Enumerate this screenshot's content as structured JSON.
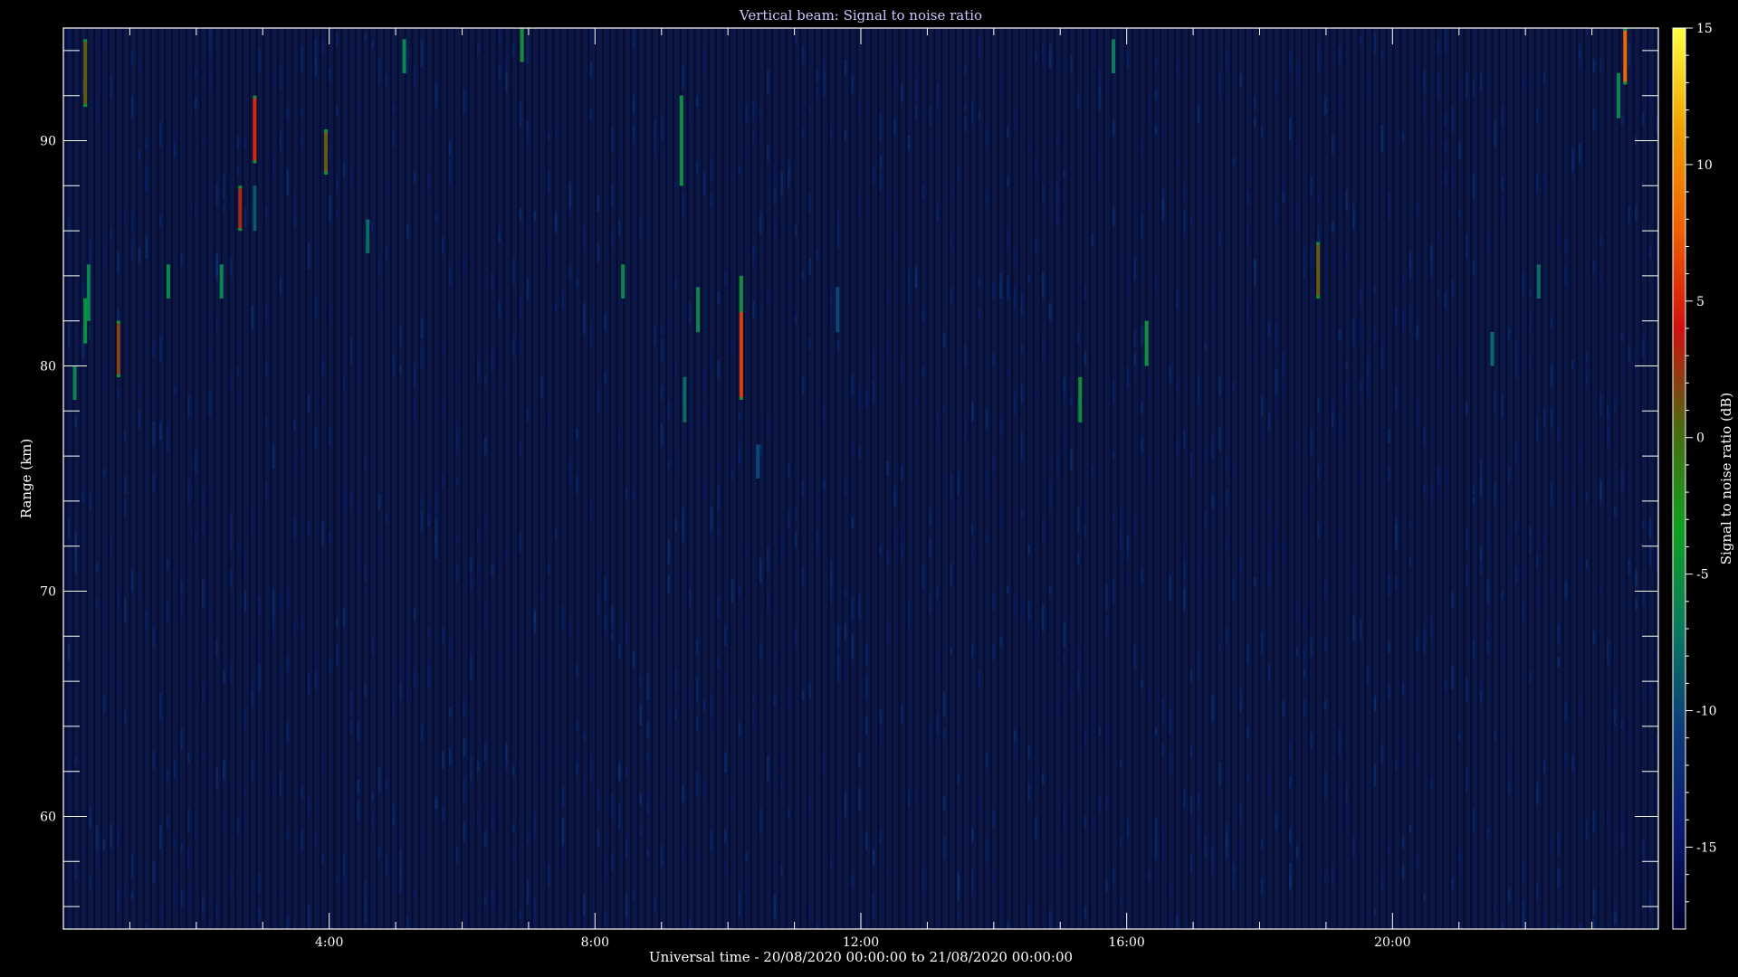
{
  "chart_data": {
    "type": "heatmap",
    "title": "Vertical beam: Signal to noise ratio",
    "xlabel": "Universal time - 20/08/2020 00:00:00 to 21/08/2020 00:00:00",
    "ylabel": "Range (km)",
    "x_unit": "hours UT",
    "xlim": [
      0,
      24
    ],
    "ylim": [
      55,
      95
    ],
    "x_ticks": [
      4,
      8,
      12,
      16,
      20
    ],
    "x_tick_labels": [
      "4:00",
      "8:00",
      "12:00",
      "16:00",
      "20:00"
    ],
    "y_ticks": [
      60,
      70,
      80,
      90
    ],
    "y_tick_labels": [
      "60",
      "70",
      "80",
      "90"
    ],
    "colorbar": {
      "label": "Signal to noise ratio (dB)",
      "range": [
        -18,
        15
      ],
      "ticks": [
        -15,
        -10,
        -5,
        0,
        5,
        10,
        15
      ],
      "tick_labels": [
        "-15",
        "-10",
        "-5",
        "0",
        "5",
        "10",
        "15"
      ],
      "colors": [
        "#000030",
        "#0a1a6e",
        "#0c3a7a",
        "#0a7a60",
        "#10a020",
        "#4a6a10",
        "#d01010",
        "#f06000",
        "#f0a000",
        "#ffff40"
      ]
    },
    "background_snr_db": -16,
    "features": [
      {
        "t": 0.17,
        "r0": 78.5,
        "r1": 80.0,
        "snr": -6
      },
      {
        "t": 0.33,
        "r0": 91.5,
        "r1": 94.5,
        "snr": 1
      },
      {
        "t": 0.33,
        "r0": 81.0,
        "r1": 83.0,
        "snr": -5
      },
      {
        "t": 0.38,
        "r0": 82.0,
        "r1": 84.5,
        "snr": -6
      },
      {
        "t": 0.83,
        "r0": 79.5,
        "r1": 82.0,
        "snr": 2
      },
      {
        "t": 1.58,
        "r0": 83.0,
        "r1": 84.5,
        "snr": -6
      },
      {
        "t": 2.38,
        "r0": 83.0,
        "r1": 84.5,
        "snr": -6
      },
      {
        "t": 2.66,
        "r0": 86.0,
        "r1": 88.0,
        "snr": 3
      },
      {
        "t": 2.88,
        "r0": 89.0,
        "r1": 92.0,
        "snr": 5
      },
      {
        "t": 2.88,
        "r0": 86.0,
        "r1": 88.0,
        "snr": -9
      },
      {
        "t": 3.95,
        "r0": 88.5,
        "r1": 90.5,
        "snr": 1
      },
      {
        "t": 4.58,
        "r0": 85.0,
        "r1": 86.5,
        "snr": -8
      },
      {
        "t": 5.13,
        "r0": 93.0,
        "r1": 94.5,
        "snr": -6
      },
      {
        "t": 6.9,
        "r0": 93.5,
        "r1": 95.0,
        "snr": -5
      },
      {
        "t": 8.42,
        "r0": 83.0,
        "r1": 84.5,
        "snr": -6
      },
      {
        "t": 9.3,
        "r0": 88.0,
        "r1": 92.0,
        "snr": -5
      },
      {
        "t": 9.35,
        "r0": 77.5,
        "r1": 79.5,
        "snr": -8
      },
      {
        "t": 9.55,
        "r0": 81.5,
        "r1": 83.5,
        "snr": -6
      },
      {
        "t": 10.2,
        "r0": 78.5,
        "r1": 82.5,
        "snr": 6
      },
      {
        "t": 10.2,
        "r0": 82.5,
        "r1": 84.0,
        "snr": -5
      },
      {
        "t": 10.45,
        "r0": 75.0,
        "r1": 76.5,
        "snr": -10
      },
      {
        "t": 11.65,
        "r0": 81.5,
        "r1": 83.5,
        "snr": -10
      },
      {
        "t": 15.3,
        "r0": 77.5,
        "r1": 79.5,
        "snr": -5
      },
      {
        "t": 15.8,
        "r0": 93.0,
        "r1": 94.5,
        "snr": -7
      },
      {
        "t": 16.3,
        "r0": 80.0,
        "r1": 82.0,
        "snr": -5
      },
      {
        "t": 18.88,
        "r0": 83.0,
        "r1": 85.5,
        "snr": 1
      },
      {
        "t": 21.5,
        "r0": 80.0,
        "r1": 81.5,
        "snr": -8
      },
      {
        "t": 22.2,
        "r0": 83.0,
        "r1": 84.5,
        "snr": -8
      },
      {
        "t": 23.4,
        "r0": 91.0,
        "r1": 93.0,
        "snr": -6
      },
      {
        "t": 23.5,
        "r0": 92.5,
        "r1": 95.0,
        "snr": 8
      }
    ]
  }
}
